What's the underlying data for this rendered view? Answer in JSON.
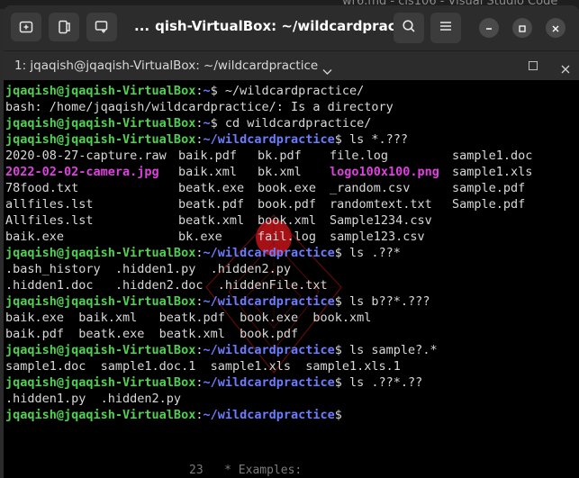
{
  "background_app": {
    "title": "wr6.md - cis106 - Visual Studio Code",
    "peek_text": "23   * Examples:"
  },
  "window": {
    "title": "qish-VirtualBox: ~/wildcardpractice",
    "title_prefix": "...",
    "buttons": {
      "new_tab": "new-tab-icon",
      "split": "split-terminal-icon",
      "new_window": "new-window-icon",
      "search": "search-icon",
      "menu": "hamburger-menu-icon",
      "minimize": "minimize-icon",
      "maximize": "maximize-icon",
      "close": "close-icon"
    }
  },
  "tab": {
    "label": "1: jqaqish@jqaqish-VirtualBox: ~/wildcardpractice"
  },
  "colors": {
    "user": "#4fd24f",
    "path": "#6a7dff",
    "image_file": "#e040e0",
    "text": "#d8d8d8",
    "terminal_bg": "#000000"
  },
  "terminal": {
    "lines": [
      {
        "type": "prompt",
        "user": "jqaqish@jqaqish-VirtualBox",
        "sep": ":",
        "path": "~",
        "cmd": "$ ~/wildcardpractice/"
      },
      {
        "type": "text",
        "text": "bash: /home/jqaqish/wildcardpractice/: Is a directory"
      },
      {
        "type": "prompt",
        "user": "jqaqish@jqaqish-VirtualBox",
        "sep": ":",
        "path": "~",
        "cmd": "$ cd wildcardpractice/"
      },
      {
        "type": "prompt",
        "user": "jqaqish@jqaqish-VirtualBox",
        "sep": ":",
        "path": "~/wildcardpractice",
        "cmd": "$ ls *.???"
      },
      {
        "type": "cols",
        "cells": [
          {
            "t": "2020-08-27-capture.raw",
            "col": 0
          },
          {
            "t": "baik.pdf",
            "col": 1
          },
          {
            "t": "bk.pdf",
            "col": 2
          },
          {
            "t": "file.log",
            "col": 3
          },
          {
            "t": "sample1.doc",
            "col": 4
          }
        ]
      },
      {
        "type": "cols",
        "cells": [
          {
            "t": "2022-02-02-camera.jpg",
            "col": 0,
            "img": true
          },
          {
            "t": "baik.xml",
            "col": 1
          },
          {
            "t": "bk.xml",
            "col": 2
          },
          {
            "t": "logo100x100.png",
            "col": 3,
            "img": true
          },
          {
            "t": "sample1.xls",
            "col": 4
          }
        ]
      },
      {
        "type": "cols",
        "cells": [
          {
            "t": "78food.txt",
            "col": 0
          },
          {
            "t": "beatk.exe",
            "col": 1
          },
          {
            "t": "book.exe",
            "col": 2
          },
          {
            "t": "_random.csv",
            "col": 3
          },
          {
            "t": "sample.pdf",
            "col": 4
          }
        ]
      },
      {
        "type": "cols",
        "cells": [
          {
            "t": "allfiles.lst",
            "col": 0
          },
          {
            "t": "beatk.pdf",
            "col": 1
          },
          {
            "t": "book.pdf",
            "col": 2
          },
          {
            "t": "randomtext.txt",
            "col": 3
          },
          {
            "t": "Sample.pdf",
            "col": 4
          }
        ]
      },
      {
        "type": "cols",
        "cells": [
          {
            "t": "Allfiles.lst",
            "col": 0
          },
          {
            "t": "beatk.xml",
            "col": 1
          },
          {
            "t": "book.xml",
            "col": 2
          },
          {
            "t": "Sample1234.csv",
            "col": 3
          }
        ]
      },
      {
        "type": "cols",
        "cells": [
          {
            "t": "baik.exe",
            "col": 0
          },
          {
            "t": "bk.exe",
            "col": 1
          },
          {
            "t": "fail.log",
            "col": 2
          },
          {
            "t": "sample123.csv",
            "col": 3
          }
        ]
      },
      {
        "type": "prompt",
        "user": "jqaqish@jqaqish-VirtualBox",
        "sep": ":",
        "path": "~/wildcardpractice",
        "cmd": "$ ls .??*"
      },
      {
        "type": "text",
        "text": ".bash_history  .hidden1.py  .hidden2.py"
      },
      {
        "type": "text",
        "text": ".hidden1.doc   .hidden2.doc  .hiddenFile.txt"
      },
      {
        "type": "prompt",
        "user": "jqaqish@jqaqish-VirtualBox",
        "sep": ":",
        "path": "~/wildcardpractice",
        "cmd": "$ ls b??*.???"
      },
      {
        "type": "text",
        "text": "baik.exe  baik.xml   beatk.pdf  book.exe  book.xml"
      },
      {
        "type": "text",
        "text": "baik.pdf  beatk.exe  beatk.xml  book.pdf"
      },
      {
        "type": "prompt",
        "user": "jqaqish@jqaqish-VirtualBox",
        "sep": ":",
        "path": "~/wildcardpractice",
        "cmd": "$ ls sample?.*"
      },
      {
        "type": "text",
        "text": "sample1.doc  sample1.doc.1  sample1.xls  sample1.xls.1"
      },
      {
        "type": "prompt",
        "user": "jqaqish@jqaqish-VirtualBox",
        "sep": ":",
        "path": "~/wildcardpractice",
        "cmd": "$ ls .??*.??"
      },
      {
        "type": "text",
        "text": ".hidden1.py  .hidden2.py"
      },
      {
        "type": "prompt",
        "user": "jqaqish@jqaqish-VirtualBox",
        "sep": ":",
        "path": "~/wildcardpractice",
        "cmd": "$"
      }
    ]
  }
}
